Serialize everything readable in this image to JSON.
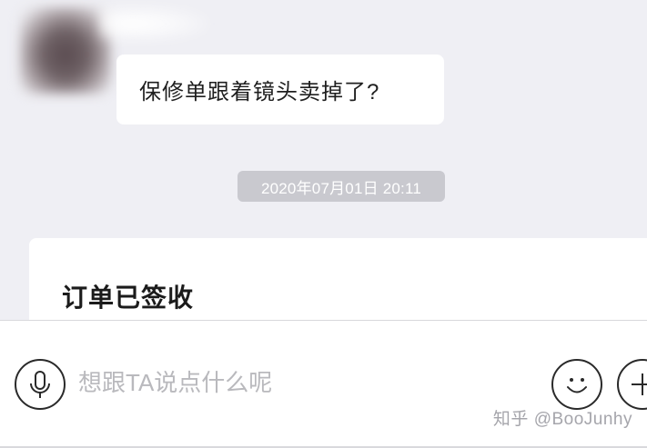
{
  "chat": {
    "message_text": "保修单跟着镜头卖掉了?",
    "timestamp": "2020年07月01日 20:11",
    "card_title": "订单已签收"
  },
  "input_bar": {
    "placeholder": "想跟TA说点什么呢",
    "value": ""
  },
  "icons": {
    "voice": "microphone-icon",
    "emoji": "smiley-icon",
    "more": "plus-icon"
  },
  "watermark": "知乎 @BooJunhy",
  "colors": {
    "chat_background": "#efeff4",
    "bubble": "#ffffff",
    "timestamp_pill": "#c9c9cf",
    "placeholder_text": "#b9b9bd",
    "watermark_text": "#a5a5ab"
  }
}
